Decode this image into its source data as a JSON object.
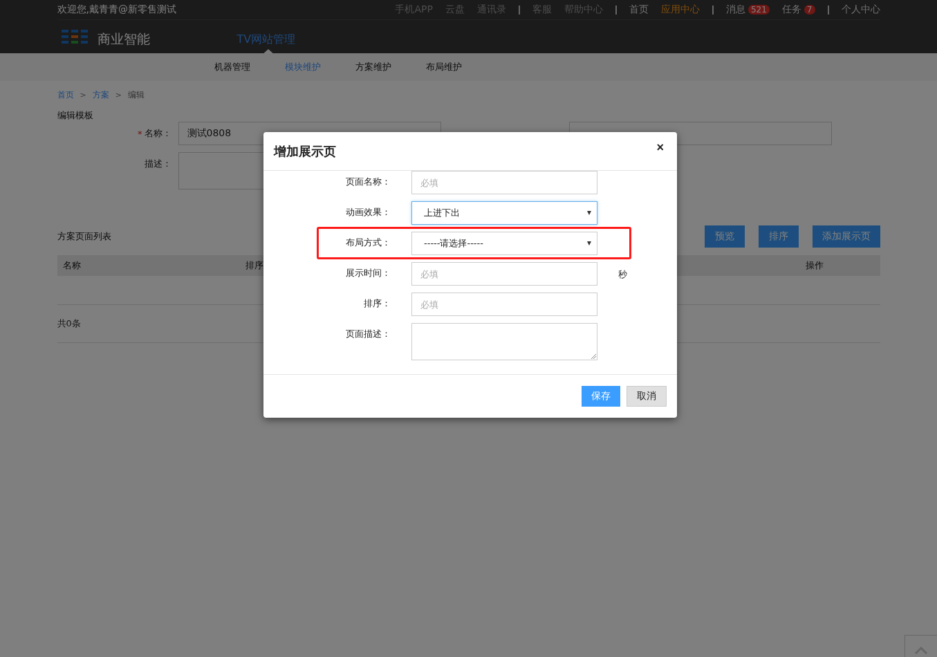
{
  "header": {
    "welcome": "欢迎您,戴青青@新零售测试",
    "link_groups": [
      [
        {
          "label": "手机APP",
          "muted": true,
          "selected": false
        },
        {
          "label": "云盘",
          "muted": true,
          "selected": false
        },
        {
          "label": "通讯录",
          "muted": true,
          "selected": false
        }
      ],
      [
        {
          "label": "客服",
          "muted": true,
          "selected": false
        },
        {
          "label": "帮助中心",
          "muted": true,
          "selected": false
        }
      ],
      [
        {
          "label": "首页",
          "muted": false,
          "selected": false
        },
        {
          "label": "应用中心",
          "muted": false,
          "selected": true
        }
      ],
      [
        {
          "label": "消息",
          "muted": false,
          "selected": false,
          "badge": "521"
        },
        {
          "label": "任务",
          "muted": false,
          "selected": false,
          "badge": "7"
        }
      ],
      [
        {
          "label": "个人中心",
          "muted": false,
          "selected": false
        }
      ]
    ],
    "logo_text": "商业智能",
    "app_title": "TV网站管理"
  },
  "subnav": [
    {
      "label": "机器管理",
      "selected": false
    },
    {
      "label": "模块维护",
      "selected": true
    },
    {
      "label": "方案维护",
      "selected": false
    },
    {
      "label": "布局维护",
      "selected": false
    }
  ],
  "breadcrumb": {
    "separator": ">",
    "items": [
      {
        "label": "首页",
        "kind": "link"
      },
      {
        "label": "方案",
        "kind": "link"
      },
      {
        "label": "编辑",
        "kind": "current"
      }
    ]
  },
  "form": {
    "title": "编辑模板",
    "fields": [
      {
        "label": "名称：",
        "required_mark": "*",
        "kind": "input",
        "value": "测试0808"
      },
      {
        "kind": "input"
      },
      {
        "label": "描述：",
        "kind": "textarea"
      }
    ]
  },
  "list": {
    "title": "方案页面列表",
    "buttons": [
      "预览",
      "排序",
      "添加展示页"
    ],
    "columns": [
      "名称",
      "排序",
      "操作"
    ],
    "total": "共0条"
  },
  "dialog": {
    "title": "增加展示页",
    "close": "×",
    "fields": [
      {
        "label": "页面名称：",
        "kind": "input",
        "placeholder": "必填"
      },
      {
        "label": "动画效果：",
        "kind": "select",
        "value": "上进下出",
        "focused": true
      },
      {
        "label": "布局方式：",
        "kind": "select",
        "value": "-----请选择-----",
        "highlighted": true
      },
      {
        "label": "展示时间：",
        "kind": "input",
        "placeholder": "必填",
        "suffix": "秒"
      },
      {
        "label": "排序：",
        "kind": "input",
        "placeholder": "必填"
      },
      {
        "label": "页面描述：",
        "kind": "textarea"
      }
    ],
    "buttons": [
      {
        "label": "保存",
        "kind": "primary"
      },
      {
        "label": "取消",
        "kind": "default"
      }
    ]
  }
}
